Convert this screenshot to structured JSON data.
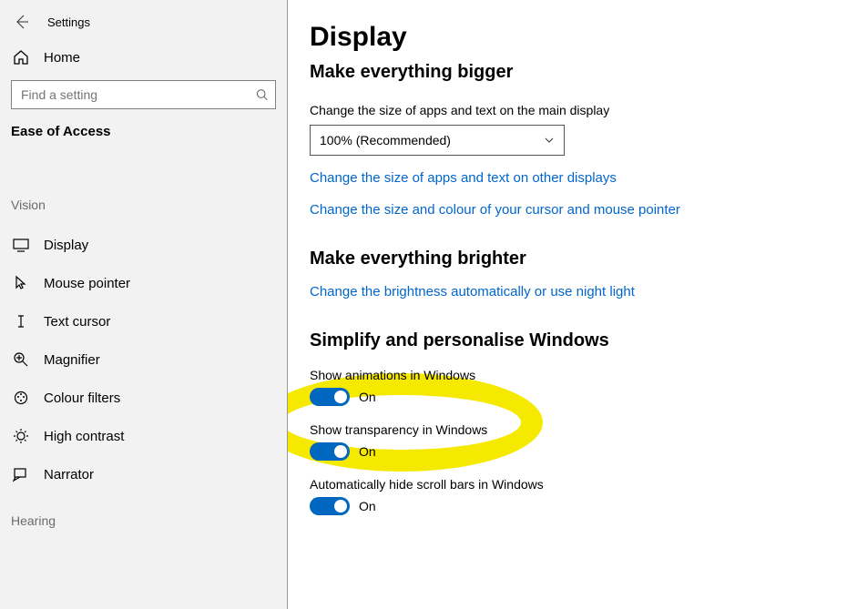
{
  "window": {
    "title": "Settings"
  },
  "sidebar": {
    "home_label": "Home",
    "search_placeholder": "Find a setting",
    "section_title": "Ease of Access",
    "group1_label": "Vision",
    "items": [
      {
        "label": "Display"
      },
      {
        "label": "Mouse pointer"
      },
      {
        "label": "Text cursor"
      },
      {
        "label": "Magnifier"
      },
      {
        "label": "Colour filters"
      },
      {
        "label": "High contrast"
      },
      {
        "label": "Narrator"
      }
    ],
    "group2_label": "Hearing"
  },
  "main": {
    "heading": "Display",
    "sub1": "Make everything bigger",
    "size_desc": "Change the size of apps and text on the main display",
    "size_value": "100% (Recommended)",
    "link1": "Change the size of apps and text on other displays",
    "link2": "Change the size and colour of your cursor and mouse pointer",
    "sub2": "Make everything brighter",
    "link3": "Change the brightness automatically or use night light",
    "sub3": "Simplify and personalise Windows",
    "toggles": [
      {
        "label": "Show animations in Windows",
        "state": "On"
      },
      {
        "label": "Show transparency in Windows",
        "state": "On"
      },
      {
        "label": "Automatically hide scroll bars in Windows",
        "state": "On"
      }
    ]
  }
}
